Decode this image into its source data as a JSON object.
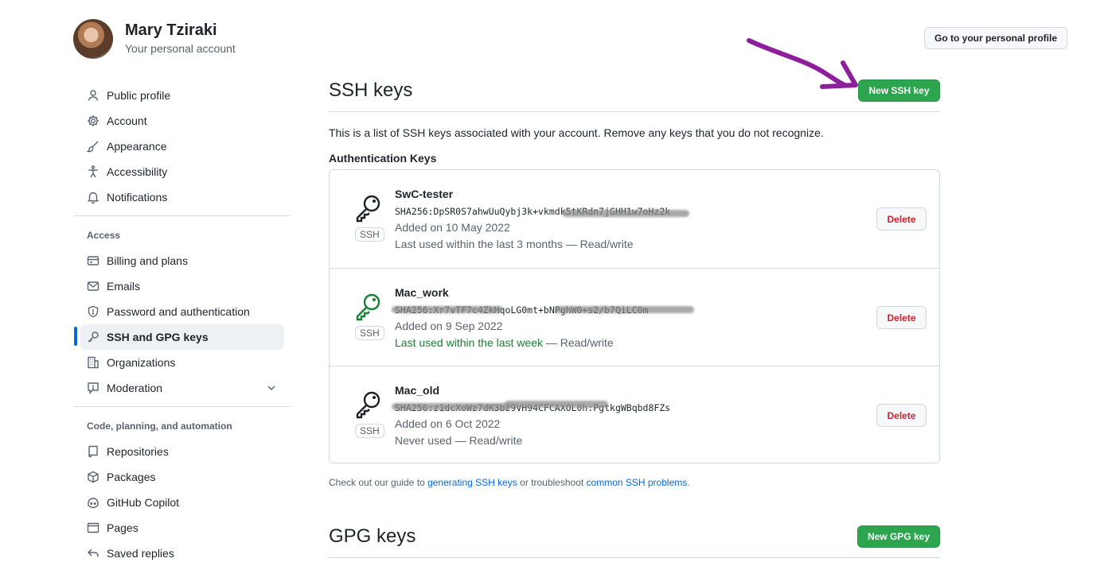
{
  "account": {
    "name": "Mary Tziraki",
    "subtitle": "Your personal account"
  },
  "header": {
    "profile_button": "Go to your personal profile"
  },
  "sidebar": {
    "items": [
      {
        "label": "Public profile",
        "icon": "person-icon"
      },
      {
        "label": "Account",
        "icon": "gear-icon"
      },
      {
        "label": "Appearance",
        "icon": "paintbrush-icon"
      },
      {
        "label": "Accessibility",
        "icon": "accessibility-icon"
      },
      {
        "label": "Notifications",
        "icon": "bell-icon"
      }
    ],
    "access_heading": "Access",
    "access_items": [
      {
        "label": "Billing and plans",
        "icon": "credit-card-icon"
      },
      {
        "label": "Emails",
        "icon": "mail-icon"
      },
      {
        "label": "Password and authentication",
        "icon": "shield-icon"
      },
      {
        "label": "SSH and GPG keys",
        "icon": "key-icon",
        "active": true
      },
      {
        "label": "Organizations",
        "icon": "organization-icon"
      },
      {
        "label": "Moderation",
        "icon": "report-icon"
      }
    ],
    "code_heading": "Code, planning, and automation",
    "code_items": [
      {
        "label": "Repositories",
        "icon": "repo-icon"
      },
      {
        "label": "Packages",
        "icon": "package-icon"
      },
      {
        "label": "GitHub Copilot",
        "icon": "copilot-icon"
      },
      {
        "label": "Pages",
        "icon": "browser-icon"
      },
      {
        "label": "Saved replies",
        "icon": "reply-icon"
      }
    ]
  },
  "ssh": {
    "title": "SSH keys",
    "new_button": "New SSH key",
    "description": "This is a list of SSH keys associated with your account. Remove any keys that you do not recognize.",
    "auth_heading": "Authentication Keys",
    "keys": [
      {
        "title": "SwC-tester",
        "fingerprint": "SHA256:DpSR0S7ahwUuQybj3k+vkmdk5tKRdn7jGHH1w7oHz2k",
        "added": "Added on 10 May 2022",
        "used_prefix": "",
        "used_highlight": "",
        "used_rest": "Last used within the last 3 months — Read/write",
        "badge": "SSH",
        "delete": "Delete",
        "key_color": "#1f2328"
      },
      {
        "title": "Mac_work",
        "fingerprint": "SHA256:Xr7vTF7c4ZkHqoLG0mt+bNPghW0+s2/b7QiLC0m",
        "added": "Added on 9 Sep 2022",
        "used_prefix": "",
        "used_highlight": "Last used within the last week",
        "used_rest": " — Read/write",
        "badge": "SSH",
        "delete": "Delete",
        "key_color": "#1a7f37"
      },
      {
        "title": "Mac_old",
        "fingerprint": "SHA256:z1dcXoWz7dK3bz9VH94CFCAXOL0h:PgtkgWBqbd8FZs",
        "added": "Added on 6 Oct 2022",
        "used_prefix": "",
        "used_highlight": "",
        "used_rest": "Never used — Read/write",
        "badge": "SSH",
        "delete": "Delete",
        "key_color": "#1f2328"
      }
    ],
    "guide_prefix": "Check out our guide to ",
    "guide_link1": "generating SSH keys",
    "guide_mid": " or troubleshoot ",
    "guide_link2": "common SSH problems",
    "guide_suffix": "."
  },
  "gpg": {
    "title": "GPG keys",
    "new_button": "New GPG key"
  },
  "colors": {
    "accent": "#0969da",
    "primary_button": "#2da44e",
    "danger": "#cf222e",
    "annotation_arrow": "#8e1f9c"
  }
}
